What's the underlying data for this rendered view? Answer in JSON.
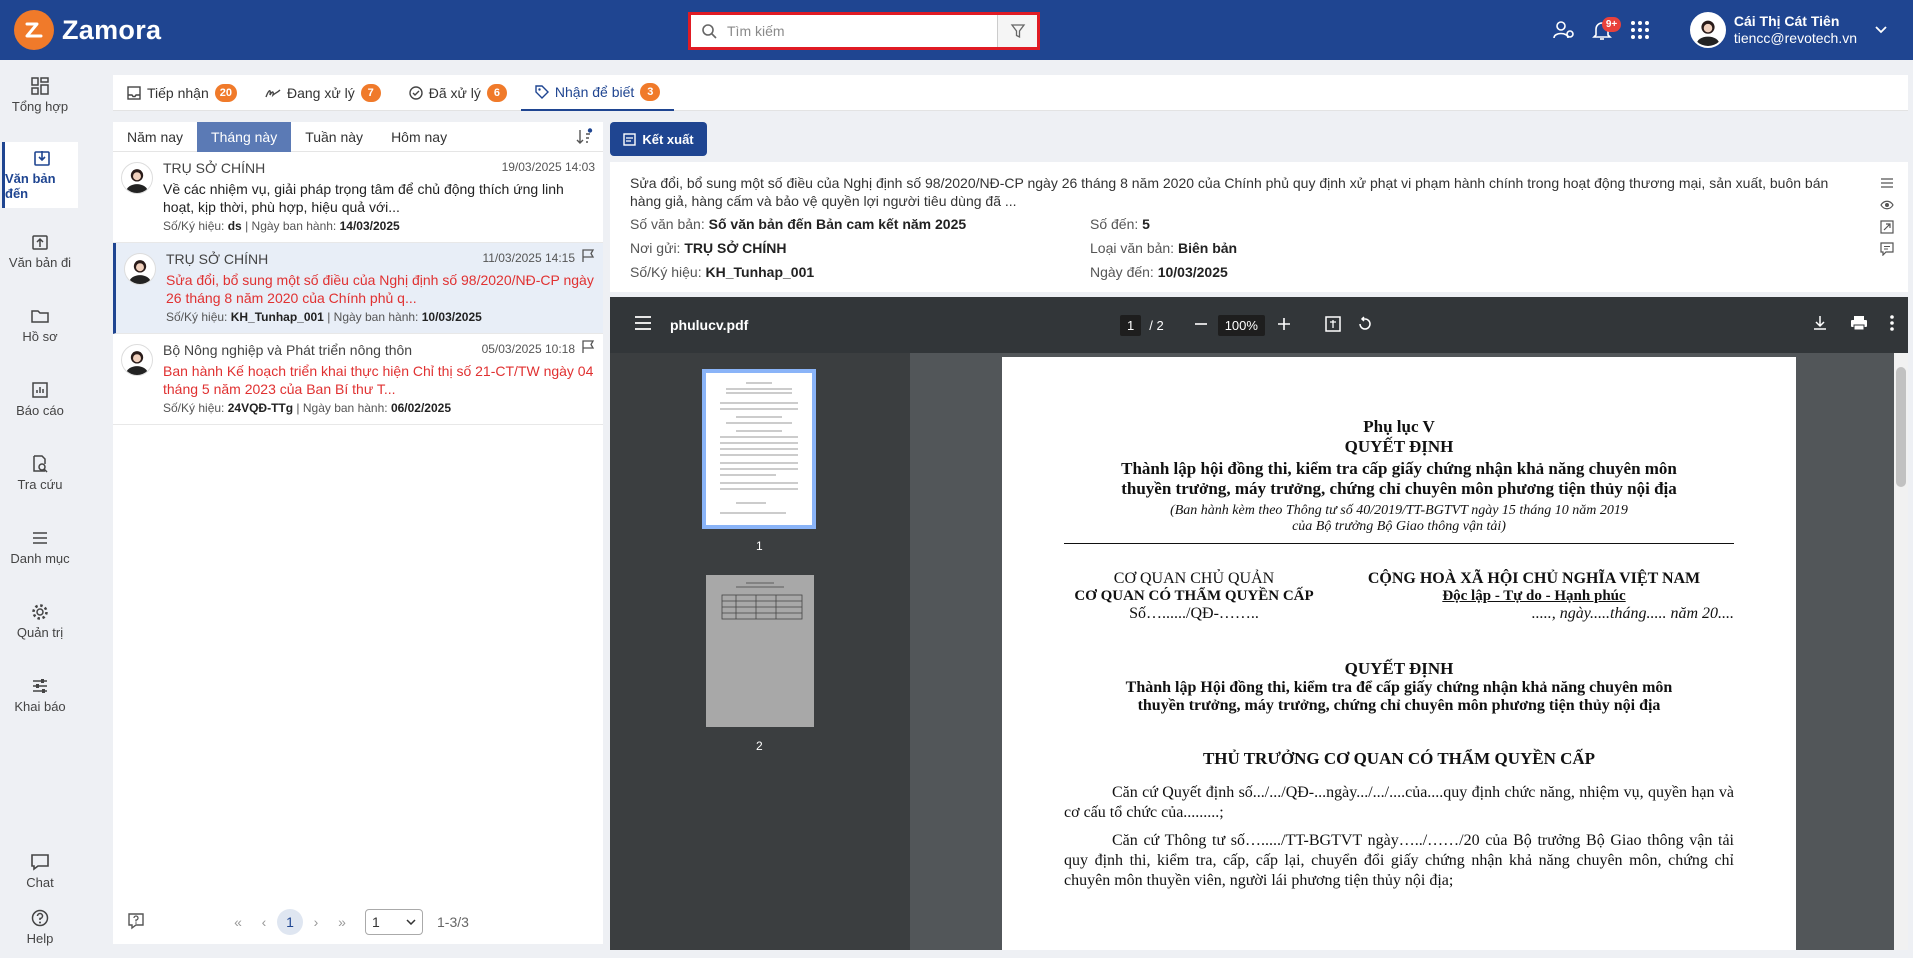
{
  "app": {
    "name": "Zamora",
    "brand_color": "#1f4591",
    "accent_color": "#f07a2a"
  },
  "search": {
    "placeholder": "Tìm kiếm"
  },
  "header": {
    "notif_badge": "9+",
    "user_name": "Cái Thị Cát Tiên",
    "user_email": "tiencc@revotech.vn"
  },
  "sidebar": {
    "items": [
      {
        "label": "Tổng hợp",
        "icon": "dashboard-icon"
      },
      {
        "label": "Văn bản đến",
        "icon": "inbox-in-icon"
      },
      {
        "label": "Văn bản đi",
        "icon": "outbox-icon"
      },
      {
        "label": "Hồ sơ",
        "icon": "folder-icon"
      },
      {
        "label": "Báo cáo",
        "icon": "report-icon"
      },
      {
        "label": "Tra cứu",
        "icon": "lookup-icon"
      },
      {
        "label": "Danh mục",
        "icon": "list-icon"
      },
      {
        "label": "Quản trị",
        "icon": "gear-icon"
      },
      {
        "label": "Khai báo",
        "icon": "sliders-icon"
      },
      {
        "label": "Chat",
        "icon": "chat-icon"
      },
      {
        "label": "Help",
        "icon": "help-icon"
      }
    ]
  },
  "tabs": [
    {
      "label": "Tiếp nhận",
      "count": "20"
    },
    {
      "label": "Đang xử lý",
      "count": "7"
    },
    {
      "label": "Đã xử lý",
      "count": "6"
    },
    {
      "label": "Nhận để biết",
      "count": "3"
    }
  ],
  "period_tabs": [
    "Năm nay",
    "Tháng này",
    "Tuần này",
    "Hôm nay"
  ],
  "documents": [
    {
      "org": "TRỤ SỞ CHÍNH",
      "date": "19/03/2025 14:03",
      "title": "Về các nhiệm vụ, giải pháp trọng tâm để chủ động thích ứng linh hoạt, kịp thời, phù hợp, hiệu quả với...",
      "code_label": "Số/Ký hiệu:",
      "code": "ds",
      "issued_label": "Ngày ban hành:",
      "issued": "14/03/2025"
    },
    {
      "org": "TRỤ SỞ CHÍNH",
      "date": "11/03/2025 14:15",
      "title": "Sửa đổi, bổ sung một số điều của Nghị định số 98/2020/NĐ-CP ngày 26 tháng 8 năm 2020 của Chính phủ q...",
      "code_label": "Số/Ký hiệu:",
      "code": "KH_Tunhap_001",
      "issued_label": "Ngày ban hành:",
      "issued": "10/03/2025"
    },
    {
      "org": "Bộ Nông nghiệp và Phát triển nông thôn",
      "date": "05/03/2025 10:18",
      "title": "Ban hành Kế hoạch triển khai thực hiện Chỉ thị số 21-CT/TW ngày 04 tháng 5 năm 2023 của Ban Bí thư T...",
      "code_label": "Số/Ký hiệu:",
      "code": "24VQĐ-TTg",
      "issued_label": "Ngày ban hành:",
      "issued": "06/02/2025"
    }
  ],
  "pager": {
    "current": "1",
    "page_size": "1",
    "range": "1-3/3"
  },
  "export_label": "Kết xuất",
  "detail": {
    "summary": "Sửa đổi, bổ sung một số điều của Nghị định số 98/2020/NĐ-CP ngày 26 tháng 8 năm 2020 của Chính phủ quy định xử phạt vi phạm hành chính trong hoạt động thương mại, sản xuất, buôn bán hàng giả, hàng cấm và bảo vệ quyền lợi người tiêu dùng đã ...",
    "so_van_ban_label": "Số văn bản:",
    "so_van_ban": "Số văn bản đến Bản cam kết năm 2025",
    "noi_gui_label": "Nơi gửi:",
    "noi_gui": "TRỤ SỞ CHÍNH",
    "so_ky_hieu_label": "Số/Ký hiệu:",
    "so_ky_hieu": "KH_Tunhap_001",
    "so_den_label": "Số đến:",
    "so_den": "5",
    "loai_label": "Loại văn bản:",
    "loai": "Biên bản",
    "ngay_den_label": "Ngày đến:",
    "ngay_den": "10/03/2025"
  },
  "pdf": {
    "filename": "phulucv.pdf",
    "page": "1",
    "total": "/ 2",
    "zoom": "100%",
    "thumb_labels": [
      "1",
      "2"
    ]
  },
  "pdf_page": {
    "l1": "Phụ lục V",
    "l2": "QUYẾT ĐỊNH",
    "l3": "Thành lập hội đồng thi, kiểm tra cấp giấy chứng nhận khả năng chuyên môn",
    "l4": "thuyền trưởng, máy trưởng, chứng chỉ chuyên môn phương tiện thủy nội địa",
    "l5": "(Ban hành kèm theo Thông tư số 40/2019/TT-BGTVT ngày 15 tháng 10 năm 2019",
    "l6": "của Bộ trưởng Bộ Giao thông vận tải)",
    "left1": "CƠ QUAN CHỦ QUẢN",
    "left2": "CƠ QUAN CÓ THẨM QUYỀN CẤP",
    "left3": "Số…....../QĐ-……..",
    "right1": "CỘNG HOÀ XÃ HỘI CHỦ NGHĨA VIỆT NAM",
    "right2": "Độc lập - Tự do - Hạnh phúc",
    "right3": "....., ngày.....tháng..... năm 20....",
    "d1": "QUYẾT ĐỊNH",
    "d2": "Thành lập Hội đồng thi, kiểm tra để cấp giấy chứng nhận khả năng chuyên môn",
    "d3": "thuyền trưởng, máy trưởng, chứng chỉ chuyên môn phương tiện thủy nội địa",
    "h": "THỦ TRƯỞNG CƠ QUAN CÓ THẨM QUYỀN CẤP",
    "p1": "Căn cứ Quyết định số.../.../QĐ-...ngày.../.../....của....quy định chức năng, nhiệm vụ, quyền hạn và cơ cấu tổ chức của.........;",
    "p2": "Căn cứ Thông tư số…...../TT-BGTVT ngày…../……/20 của Bộ trưởng Bộ Giao thông vận tải quy định thi, kiểm tra, cấp, cấp lại, chuyển đổi giấy chứng nhận khả năng chuyên môn, chứng chỉ chuyên môn thuyền viên, người lái phương tiện thủy nội địa;"
  }
}
